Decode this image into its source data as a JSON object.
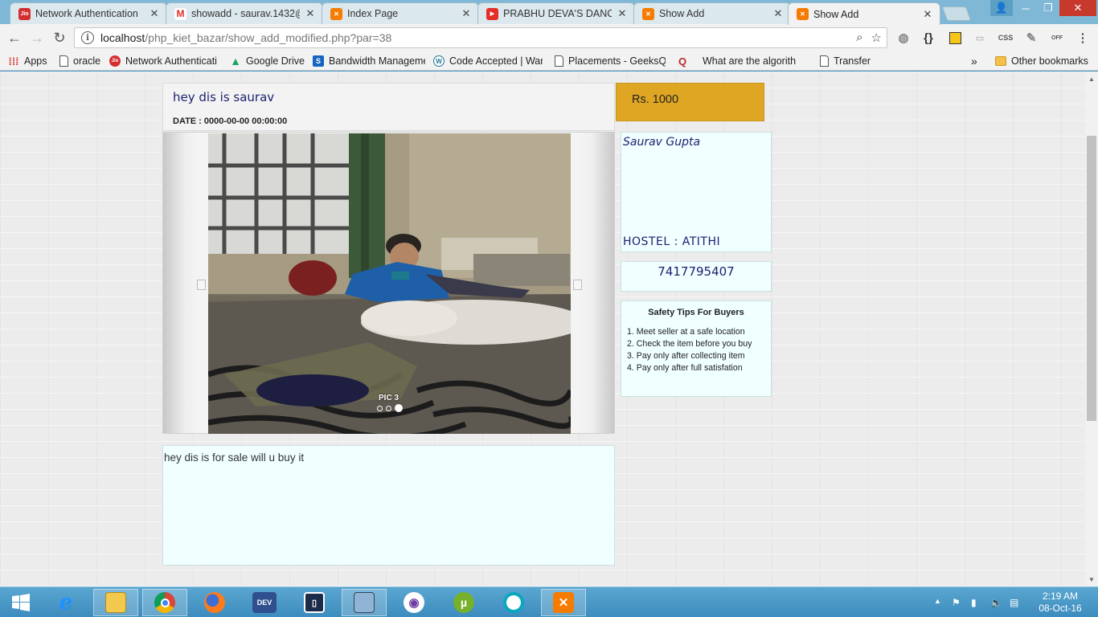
{
  "tabs": [
    {
      "title": "Network Authentication",
      "icon": "jio-icon",
      "color": "#d32f2f",
      "glyph": "Jio"
    },
    {
      "title": "showadd - saurav.1432@",
      "icon": "gmail-icon",
      "color": "#ffffff",
      "glyph": "M"
    },
    {
      "title": "Index Page",
      "icon": "xampp-icon",
      "color": "#f57c00",
      "glyph": "X"
    },
    {
      "title": "PRABHU DEVA'S DANCE",
      "icon": "youtube-icon",
      "color": "#e52d27",
      "glyph": "▶"
    },
    {
      "title": "Show Add",
      "icon": "xampp-icon",
      "color": "#f57c00",
      "glyph": "X"
    },
    {
      "title": "Show Add",
      "icon": "xampp-icon",
      "color": "#f57c00",
      "glyph": "X"
    }
  ],
  "address": {
    "host": "localhost",
    "path": "/php_kiet_bazar/show_add_modified.php?par=38"
  },
  "bookmarks": [
    {
      "label": "Apps",
      "icon": "apps-grid-icon"
    },
    {
      "label": "oracle",
      "icon": "page-icon"
    },
    {
      "label": "Network Authenticati",
      "icon": "jio-icon"
    },
    {
      "label": "Google Drive",
      "icon": "google-drive-icon"
    },
    {
      "label": "Bandwidth Manageme",
      "icon": "s-icon"
    },
    {
      "label": "Code Accepted | War",
      "icon": "wordpress-icon"
    },
    {
      "label": "Placements - GeeksQ",
      "icon": "page-icon"
    },
    {
      "label": "What are the algorith",
      "icon": "quora-icon"
    },
    {
      "label": "Transfer",
      "icon": "page-icon"
    }
  ],
  "bookmarks_more": "»",
  "other_bookmarks": "Other bookmarks",
  "ad": {
    "title": "hey dis is saurav",
    "date": "DATE : 0000-00-00 00:00:00",
    "price": "Rs. 1000",
    "pic_label": "PIC 3",
    "pic_count": 3,
    "pic_active": 3,
    "description": "hey dis is for sale will u buy it"
  },
  "seller": {
    "name": "Saurav Gupta",
    "hostel": "HOSTEL : ATITHI",
    "phone": "7417795407"
  },
  "safety": {
    "heading": "Safety Tips For Buyers",
    "tips": [
      "1. Meet seller at a safe location",
      "2. Check the item before you buy",
      "3. Pay only after collecting item",
      "4. Pay only after full satisfation"
    ]
  },
  "taskbar": {
    "time": "2:19 AM",
    "date": "08-Oct-16"
  },
  "colors": {
    "price_bg": "#dea623",
    "panel_bg": "#f0ffff",
    "accent_text": "#1b1f6e"
  }
}
